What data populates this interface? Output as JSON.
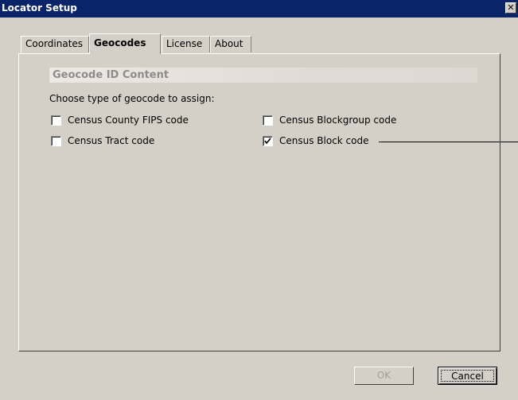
{
  "window": {
    "title": "Locator Setup",
    "close_glyph": "✕"
  },
  "tabs": [
    {
      "label": "Coordinates",
      "active": false
    },
    {
      "label": "Geocodes",
      "active": true
    },
    {
      "label": "License",
      "active": false
    },
    {
      "label": "About",
      "active": false
    }
  ],
  "geocodes": {
    "section_title": "Geocode ID Content",
    "prompt": "Choose type of geocode to assign:",
    "options": [
      {
        "label": "Census County FIPS code",
        "checked": false
      },
      {
        "label": "Census Blockgroup code",
        "checked": false
      },
      {
        "label": "Census Tract code",
        "checked": false
      },
      {
        "label": "Census Block code",
        "checked": true
      }
    ]
  },
  "buttons": {
    "ok": "OK",
    "cancel": "Cancel"
  },
  "icons": {
    "close": "close-icon",
    "check": "checkmark-icon"
  },
  "colors": {
    "titlebar": "#0a246a",
    "background": "#d4d0c8",
    "disabled_text": "#a0a0a0"
  }
}
